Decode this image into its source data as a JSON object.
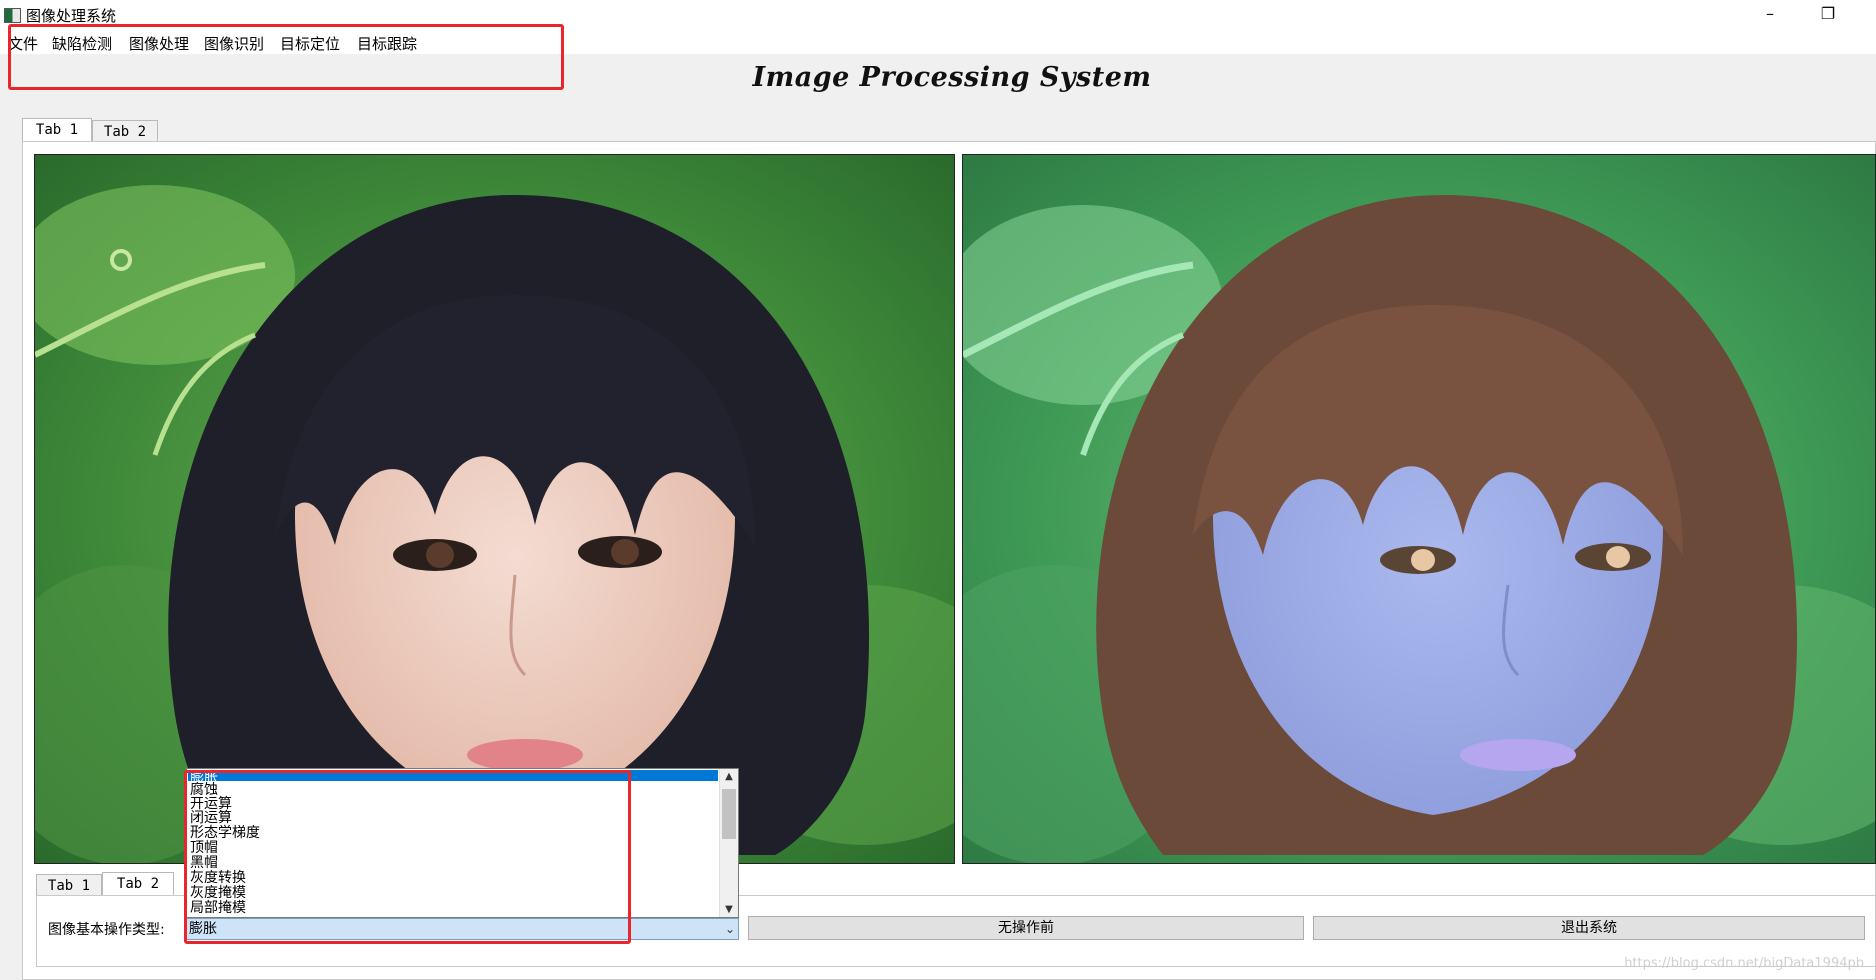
{
  "window": {
    "title": "图像处理系统",
    "minimize_glyph": "–",
    "maximize_glyph": "❐"
  },
  "menu": {
    "items": [
      "文件",
      "缺陷检测",
      "图像处理",
      "图像识别",
      "目标定位",
      "目标跟踪"
    ]
  },
  "heading": "Image Processing System",
  "top_tabs": [
    "Tab 1",
    "Tab 2"
  ],
  "bottom_tabs": [
    "Tab 1",
    "Tab 2"
  ],
  "controls": {
    "op_type_label": "图像基本操作类型:",
    "op_type_value": "膨胀",
    "button_before": "无操作前",
    "button_exit": "退出系统"
  },
  "dropdown": {
    "options": [
      "膨胀",
      "腐蚀",
      "开运算",
      "闭运算",
      "形态学梯度",
      "顶帽",
      "黑帽",
      "灰度转换",
      "灰度掩模",
      "局部掩模"
    ],
    "selected_index": 0
  },
  "images": {
    "left": {
      "description_icon": "original-photo"
    },
    "right": {
      "description_icon": "processed-photo"
    }
  },
  "colors": {
    "highlight": "#e8262c",
    "selection": "#0078d7"
  },
  "watermark": "https://blog.csdn.net/bigData1994pb"
}
